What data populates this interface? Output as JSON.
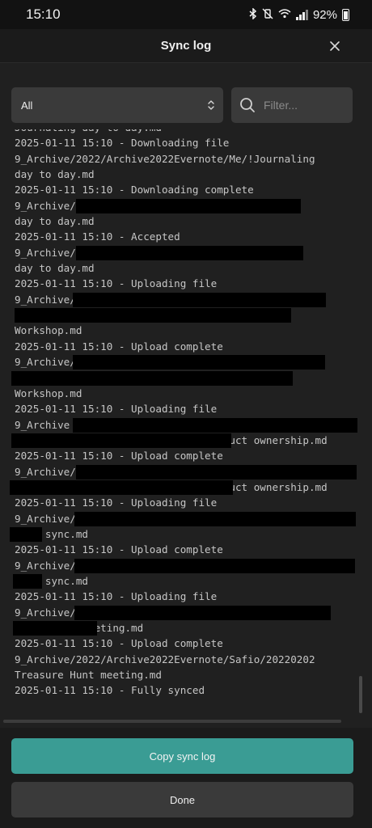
{
  "status": {
    "time": "15:10",
    "battery": "92%"
  },
  "header": {
    "title": "Sync log"
  },
  "filter": {
    "selected": "All",
    "placeholder": "Filter..."
  },
  "log_lines": [
    "Journaling day to day.md",
    "2025-01-11 15:10 - Downloading file",
    "9_Archive/2022/Archive2022Evernote/Me/!Journaling",
    "day to day.md",
    "2025-01-11 15:10 - Downloading complete",
    "9_Archive/                                ing",
    "day to day.md",
    "2025-01-11 15:10 - Accepted",
    "9_Archive/                                ing",
    "day to day.md",
    "2025-01-11 15:10 - Uploading file",
    "9_Archive/",
    "",
    "Workshop.md",
    "2025-01-11 15:10 - Upload complete",
    "9_Archive/",
    "",
    "Workshop.md",
    "2025-01-11 15:10 - Uploading file",
    "9_Archive",
    "                               product ownership.md",
    "2025-01-11 15:10 - Upload complete",
    "9_Archive/",
    "                               product ownership.md",
    "2025-01-11 15:10 - Uploading file",
    "9_Archive/",
    "     sync.md",
    "2025-01-11 15:10 - Upload complete",
    "9_Archive/",
    "     sync.md",
    "2025-01-11 15:10 - Uploading file",
    "9_Archive/",
    "           meeting.md",
    "2025-01-11 15:10 - Upload complete",
    "9_Archive/2022/Archive2022Evernote/Safio/20220202",
    "Treasure Hunt meeting.md",
    "2025-01-11 15:10 - Fully synced"
  ],
  "footer": {
    "copy_label": "Copy sync log",
    "done_label": "Done"
  }
}
